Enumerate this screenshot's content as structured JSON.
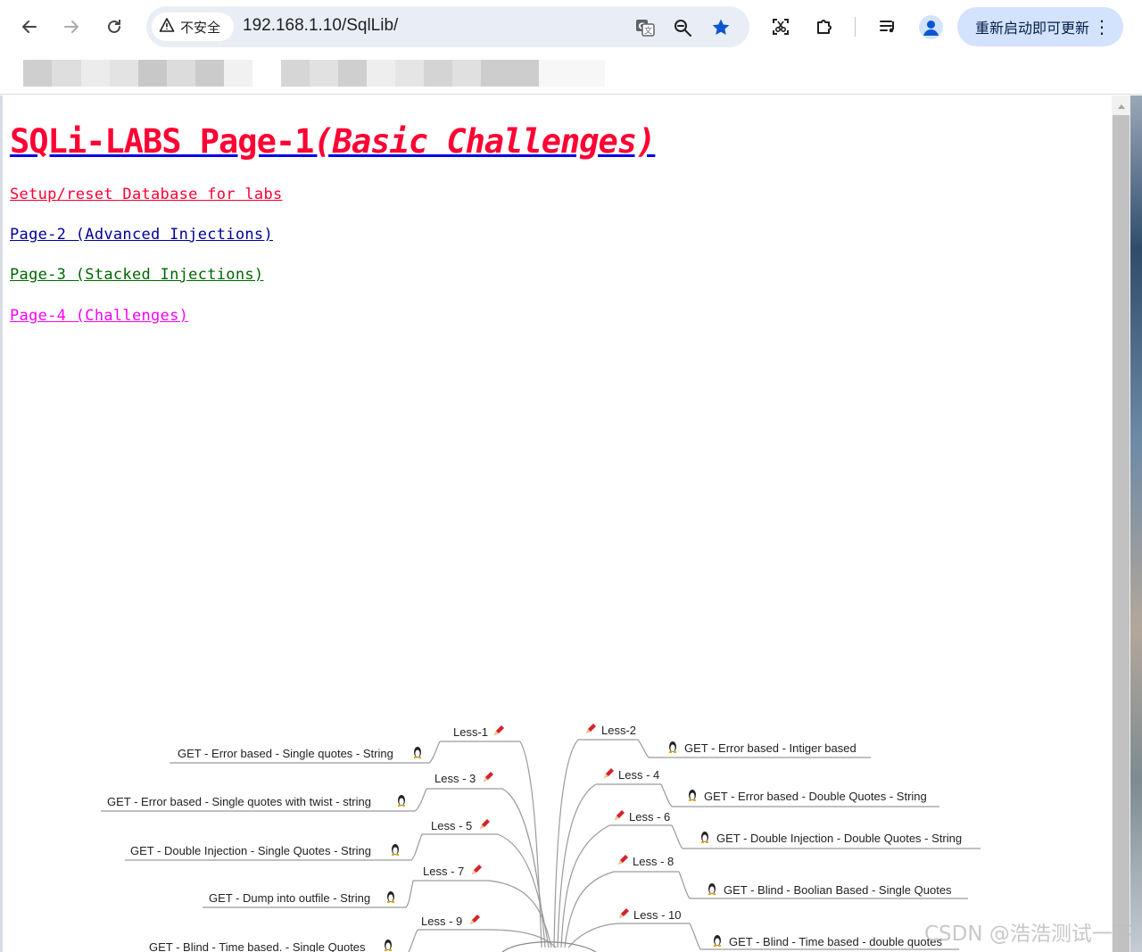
{
  "browser": {
    "security_label": "不安全",
    "url": "192.168.1.10/SqlLib/",
    "update_button_label": "重新启动即可更新",
    "icons": [
      "back-icon",
      "forward-icon",
      "reload-icon",
      "warning-icon",
      "translate-icon",
      "zoom-icon",
      "star-icon",
      "screenshot-icon",
      "extensions-icon",
      "media-icon",
      "profile-icon",
      "menu-icon"
    ]
  },
  "page": {
    "title_main": "SQLi-LABS Page-1",
    "title_sub": "(Basic Challenges)",
    "links": [
      {
        "label": "Setup/reset Database for labs",
        "color": "#ff0033"
      },
      {
        "label": "Page-2 (Advanced Injections)",
        "color": "#000099"
      },
      {
        "label": "Page-3 (Stacked Injections)",
        "color": "#006600"
      },
      {
        "label": "Page-4 (Challenges)",
        "color": "#ff00ff"
      }
    ]
  },
  "mindmap": {
    "left": [
      {
        "less": "Less-1",
        "desc": "GET - Error based - Single quotes - String"
      },
      {
        "less": "Less - 3",
        "desc": "GET - Error based - Single quotes with twist - string"
      },
      {
        "less": "Less - 5",
        "desc": "GET - Double Injection - Single Quotes - String"
      },
      {
        "less": "Less - 7",
        "desc": "GET - Dump into outfile - String"
      },
      {
        "less": "Less - 9",
        "desc": "GET - Blind - Time based. -  Single Quotes"
      }
    ],
    "right": [
      {
        "less": "Less-2",
        "desc": "GET - Error based - Intiger based"
      },
      {
        "less": "Less - 4",
        "desc": "GET - Error based - Double Quotes - String"
      },
      {
        "less": "Less - 6",
        "desc": "GET - Double Injection - Double Quotes - String"
      },
      {
        "less": "Less - 8",
        "desc": "GET - Blind - Boolian Based - Single Quotes"
      },
      {
        "less": "Less - 10",
        "desc": "GET - Blind - Time based - double quotes"
      }
    ]
  },
  "watermark": "CSDN @浩浩测试一下"
}
